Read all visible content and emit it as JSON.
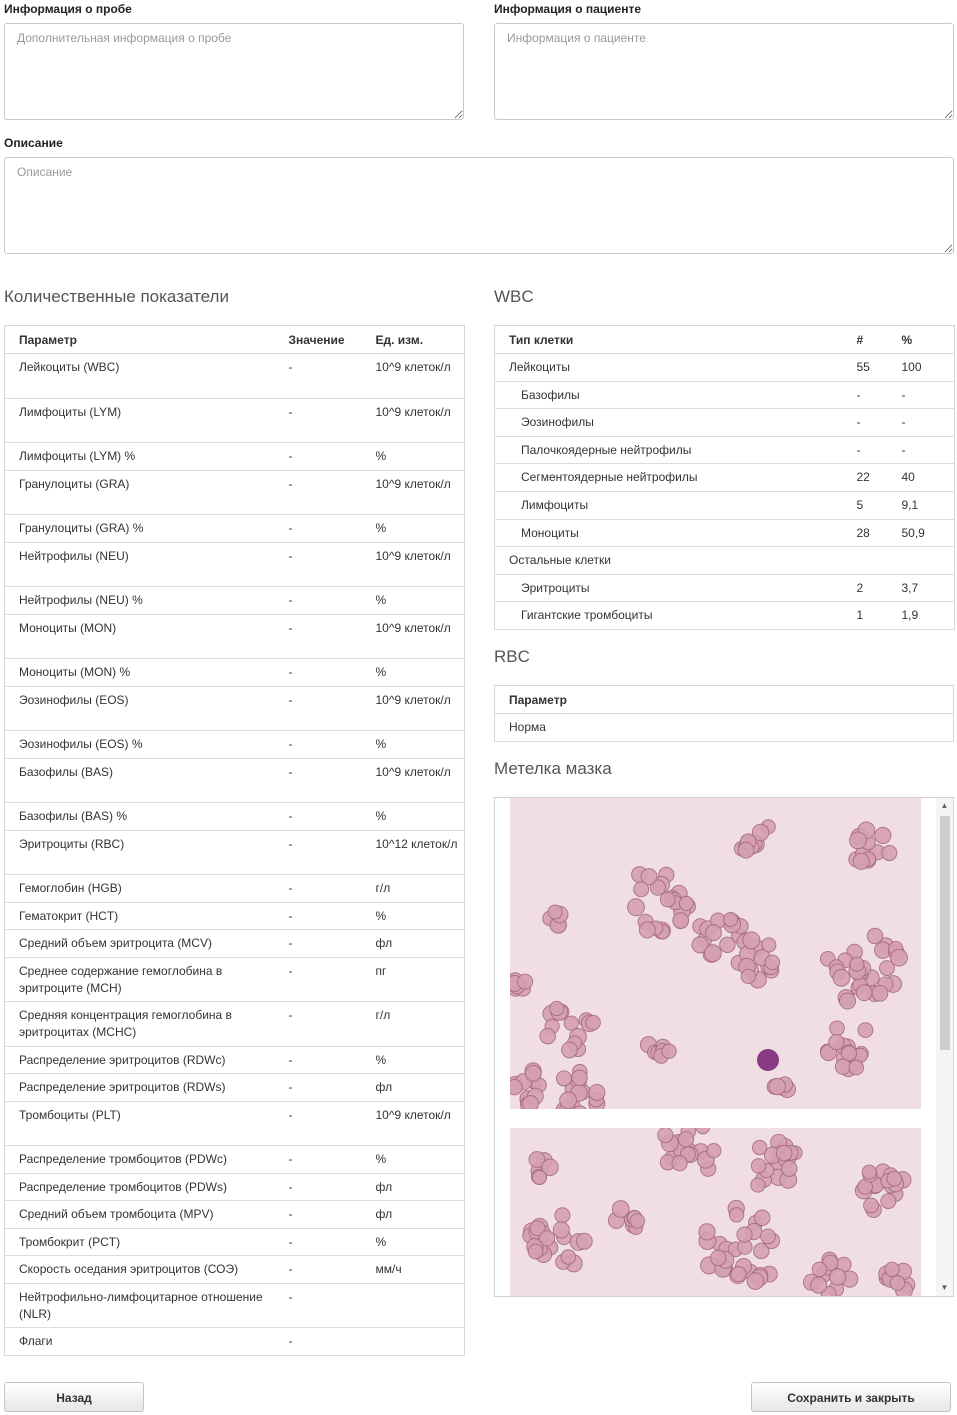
{
  "sample_info": {
    "label": "Информация о пробе",
    "placeholder": "Дополнительная информация о пробе",
    "value": ""
  },
  "patient_info": {
    "label": "Информация о пациенте",
    "placeholder": "Информация о пациенте",
    "value": ""
  },
  "description": {
    "label": "Описание",
    "placeholder": "Описание",
    "value": ""
  },
  "quantitative": {
    "title": "Количественные показатели",
    "headers": [
      "Параметр",
      "Значение",
      "Ед. изм."
    ],
    "rows": [
      {
        "param": "Лейкоциты (WBC)",
        "value": "-",
        "unit": "10^9 клеток/л"
      },
      {
        "param": "Лимфоциты (LYM)",
        "value": "-",
        "unit": "10^9 клеток/л"
      },
      {
        "param": "Лимфоциты (LYM) %",
        "value": "-",
        "unit": "%"
      },
      {
        "param": "Гранулоциты (GRA)",
        "value": "-",
        "unit": "10^9 клеток/л"
      },
      {
        "param": "Гранулоциты (GRA) %",
        "value": "-",
        "unit": "%"
      },
      {
        "param": "Нейтрофилы (NEU)",
        "value": "-",
        "unit": "10^9 клеток/л"
      },
      {
        "param": "Нейтрофилы (NEU) %",
        "value": "-",
        "unit": "%"
      },
      {
        "param": "Моноциты (MON)",
        "value": "-",
        "unit": "10^9 клеток/л"
      },
      {
        "param": "Моноциты (MON) %",
        "value": "-",
        "unit": "%"
      },
      {
        "param": "Эозинофилы (EOS)",
        "value": "-",
        "unit": "10^9 клеток/л"
      },
      {
        "param": "Эозинофилы (EOS) %",
        "value": "-",
        "unit": "%"
      },
      {
        "param": "Базофилы (BAS)",
        "value": "-",
        "unit": "10^9 клеток/л"
      },
      {
        "param": "Базофилы (BAS) %",
        "value": "-",
        "unit": "%"
      },
      {
        "param": "Эритроциты (RBC)",
        "value": "-",
        "unit": "10^12 клеток/л"
      },
      {
        "param": "Гемоглобин (HGB)",
        "value": "-",
        "unit": "г/л"
      },
      {
        "param": "Гематокрит (HCT)",
        "value": "-",
        "unit": "%"
      },
      {
        "param": "Средний объем эритроцита (MCV)",
        "value": "-",
        "unit": "фл"
      },
      {
        "param": "Среднее содержание гемоглобина в эритроците (MCH)",
        "value": "-",
        "unit": "пг"
      },
      {
        "param": "Средняя концентрация гемоглобина в эритроцитах (MCHC)",
        "value": "-",
        "unit": "г/л"
      },
      {
        "param": "Распределение эритроцитов (RDWc)",
        "value": "-",
        "unit": "%"
      },
      {
        "param": "Распределение эритроцитов (RDWs)",
        "value": "-",
        "unit": "фл"
      },
      {
        "param": "Тромбоциты (PLT)",
        "value": "-",
        "unit": "10^9 клеток/л"
      },
      {
        "param": "Распределение тромбоцитов (PDWc)",
        "value": "-",
        "unit": "%"
      },
      {
        "param": "Распределение тромбоцитов (PDWs)",
        "value": "-",
        "unit": "фл"
      },
      {
        "param": "Средний объем тромбоцита (MPV)",
        "value": "-",
        "unit": "фл"
      },
      {
        "param": "Тромбокрит (PCT)",
        "value": "-",
        "unit": "%"
      },
      {
        "param": "Скорость оседания эритроцитов (СОЭ)",
        "value": "-",
        "unit": "мм/ч"
      },
      {
        "param": "Нейтрофильно-лимфоцитарное отношение (NLR)",
        "value": "-",
        "unit": ""
      },
      {
        "param": "Флаги",
        "value": "-",
        "unit": ""
      }
    ]
  },
  "wbc": {
    "title": "WBC",
    "headers": [
      "Тип клетки",
      "#",
      "%"
    ],
    "rows": [
      {
        "type": "Лейкоциты",
        "count": "55",
        "pct": "100",
        "indent": false
      },
      {
        "type": "Базофилы",
        "count": "-",
        "pct": "-",
        "indent": true
      },
      {
        "type": "Эозинофилы",
        "count": "-",
        "pct": "-",
        "indent": true
      },
      {
        "type": "Палочкоядерные нейтрофилы",
        "count": "-",
        "pct": "-",
        "indent": true
      },
      {
        "type": "Сегментоядерные нейтрофилы",
        "count": "22",
        "pct": "40",
        "indent": true
      },
      {
        "type": "Лимфоциты",
        "count": "5",
        "pct": "9,1",
        "indent": true
      },
      {
        "type": "Моноциты",
        "count": "28",
        "pct": "50,9",
        "indent": true
      },
      {
        "type": "Остальные клетки",
        "count": "",
        "pct": "",
        "indent": false
      },
      {
        "type": "Эритроциты",
        "count": "2",
        "pct": "3,7",
        "indent": true
      },
      {
        "type": "Гигантские тромбоциты",
        "count": "1",
        "pct": "1,9",
        "indent": true
      }
    ]
  },
  "rbc": {
    "title": "RBC",
    "header": "Параметр",
    "rows": [
      "Норма"
    ]
  },
  "smear": {
    "title": "Метелка мазка",
    "images": [
      "smear-image-1",
      "smear-image-2"
    ],
    "colors": {
      "background": "#f0dee4",
      "cell_fill": "#d6a0b3",
      "cell_edge": "#a66b84",
      "wbc_fill": "#8a3a82"
    }
  },
  "buttons": {
    "back": "Назад",
    "save_close": "Сохранить и закрыть"
  }
}
